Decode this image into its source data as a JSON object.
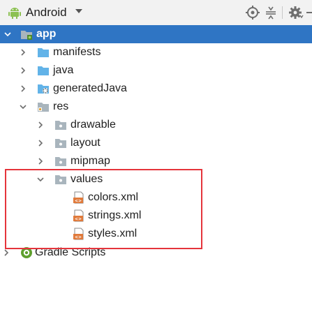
{
  "toolbar": {
    "view_label": "Android",
    "icons": [
      "android-icon",
      "dropdown-arrow-icon",
      "locate-icon",
      "collapse-icon",
      "settings-gear-icon",
      "hide-icon"
    ]
  },
  "tree": {
    "app": "app",
    "manifests": "manifests",
    "java": "java",
    "generatedJava": "generatedJava",
    "res": "res",
    "drawable": "drawable",
    "layout": "layout",
    "mipmap": "mipmap",
    "values": "values",
    "colors": "colors.xml",
    "strings": "strings.xml",
    "styles": "styles.xml",
    "gradle": "Gradle Scripts"
  },
  "colors": {
    "selection": "#2f75c4",
    "folder_blue": "#62b3e8",
    "folder_gray": "#a9b5bd",
    "xml_orange": "#e07a3b",
    "highlight_red": "#e5343b"
  }
}
